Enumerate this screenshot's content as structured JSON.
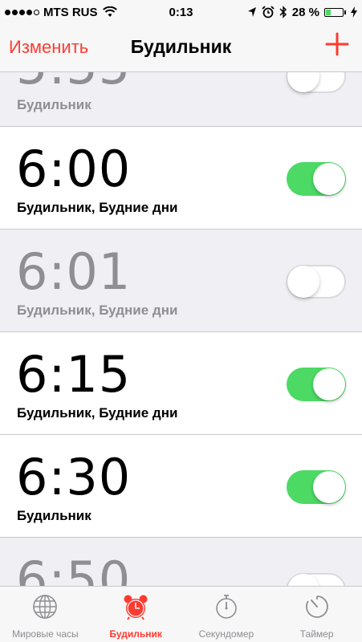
{
  "status_bar": {
    "carrier": "MTS RUS",
    "time": "0:13",
    "battery_percent": "28 %",
    "battery_level": 0.28
  },
  "nav": {
    "edit_label": "Изменить",
    "title": "Будильник",
    "add_icon": "plus-icon"
  },
  "alarms": [
    {
      "time": "5:55",
      "label": "Будильник",
      "enabled": false
    },
    {
      "time": "6:00",
      "label": "Будильник, Будние дни",
      "enabled": true
    },
    {
      "time": "6:01",
      "label": "Будильник, Будние дни",
      "enabled": false
    },
    {
      "time": "6:15",
      "label": "Будильник, Будние дни",
      "enabled": true
    },
    {
      "time": "6:30",
      "label": "Будильник",
      "enabled": true
    },
    {
      "time": "6:50",
      "label": "",
      "enabled": false
    }
  ],
  "tabs": [
    {
      "label": "Мировые часы",
      "icon": "globe-icon",
      "active": false
    },
    {
      "label": "Будильник",
      "icon": "alarm-clock-icon",
      "active": true
    },
    {
      "label": "Секундомер",
      "icon": "stopwatch-icon",
      "active": false
    },
    {
      "label": "Таймер",
      "icon": "timer-icon",
      "active": false
    }
  ],
  "colors": {
    "accent": "#ff3b30",
    "toggle_on": "#4cd964",
    "inactive": "#8e8e93"
  }
}
